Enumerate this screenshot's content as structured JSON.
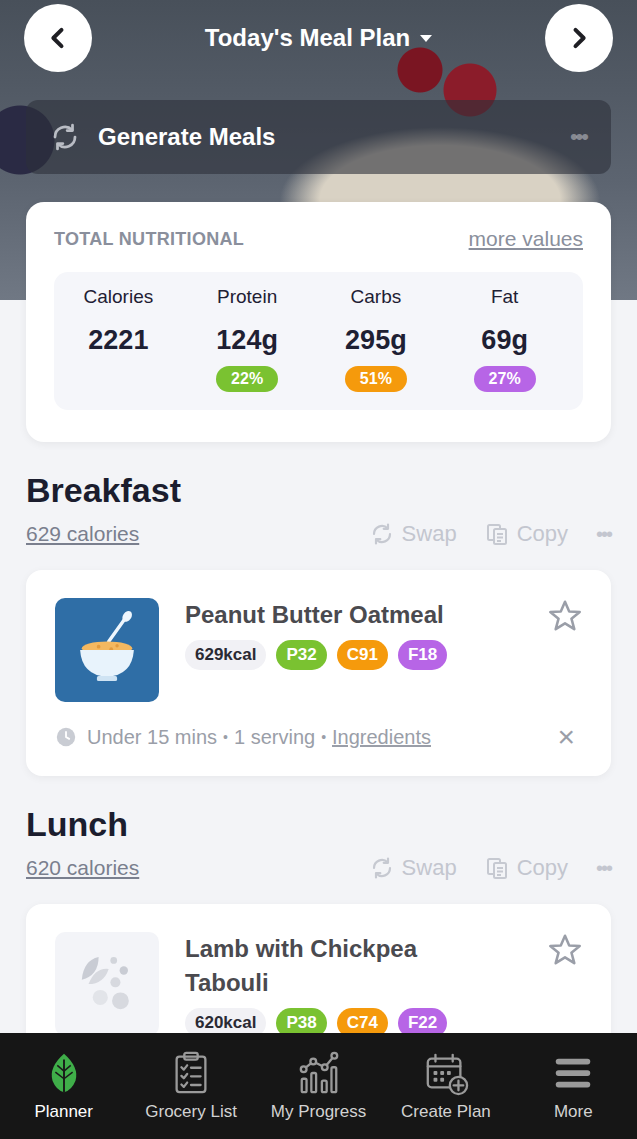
{
  "header": {
    "title": "Today's Meal Plan"
  },
  "generate": {
    "label": "Generate Meals",
    "menu": "•••"
  },
  "nutrition": {
    "title": "TOTAL NUTRITIONAL",
    "link": "more values",
    "stats": [
      {
        "label": "Calories",
        "value": "2221"
      },
      {
        "label": "Protein",
        "value": "124g",
        "percent": "22%",
        "color": "#7ac231"
      },
      {
        "label": "Carbs",
        "value": "295g",
        "percent": "51%",
        "color": "#f59a0c"
      },
      {
        "label": "Fat",
        "value": "69g",
        "percent": "27%",
        "color": "#b765e6"
      }
    ]
  },
  "meals": [
    {
      "name": "Breakfast",
      "calories": "629 calories",
      "actions": [
        {
          "label": "Swap",
          "kind": "swap"
        },
        {
          "label": "Copy",
          "kind": "copy"
        }
      ],
      "menu": "•••",
      "items": [
        {
          "title": "Peanut Butter Oatmeal",
          "kind": "illustrated",
          "favorite": false,
          "tags": [
            {
              "text": "629kcal",
              "kind": "energy"
            },
            {
              "text": "P32",
              "kind": "macro",
              "color": "#7ac231"
            },
            {
              "text": "C91",
              "kind": "macro",
              "color": "#f59a0c"
            },
            {
              "text": "F18",
              "kind": "macro",
              "color": "#b765e6"
            }
          ],
          "meta": [
            "Under 15 mins",
            "1 serving"
          ],
          "separator": "•",
          "link": "Ingredients",
          "remove": "×"
        }
      ]
    },
    {
      "name": "Lunch",
      "calories": "620 calories",
      "actions": [
        {
          "label": "Swap",
          "kind": "swap"
        },
        {
          "label": "Copy",
          "kind": "copy"
        }
      ],
      "menu": "•••",
      "items": [
        {
          "title": "Lamb with Chickpea Tabouli",
          "kind": "placeholder",
          "favorite": false,
          "tags": [
            {
              "text": "620kcal",
              "kind": "energy"
            },
            {
              "text": "P38",
              "kind": "macro",
              "color": "#7ac231"
            },
            {
              "text": "C74",
              "kind": "macro",
              "color": "#f59a0c"
            },
            {
              "text": "F22",
              "kind": "macro",
              "color": "#b765e6"
            }
          ]
        }
      ]
    }
  ],
  "nav": [
    {
      "label": "Planner",
      "kind": "planner",
      "selected": true
    },
    {
      "label": "Grocery List",
      "kind": "grocery",
      "selected": false
    },
    {
      "label": "My Progress",
      "kind": "progress",
      "selected": false
    },
    {
      "label": "Create Plan",
      "kind": "create",
      "selected": false
    },
    {
      "label": "More",
      "kind": "more",
      "selected": false
    }
  ]
}
